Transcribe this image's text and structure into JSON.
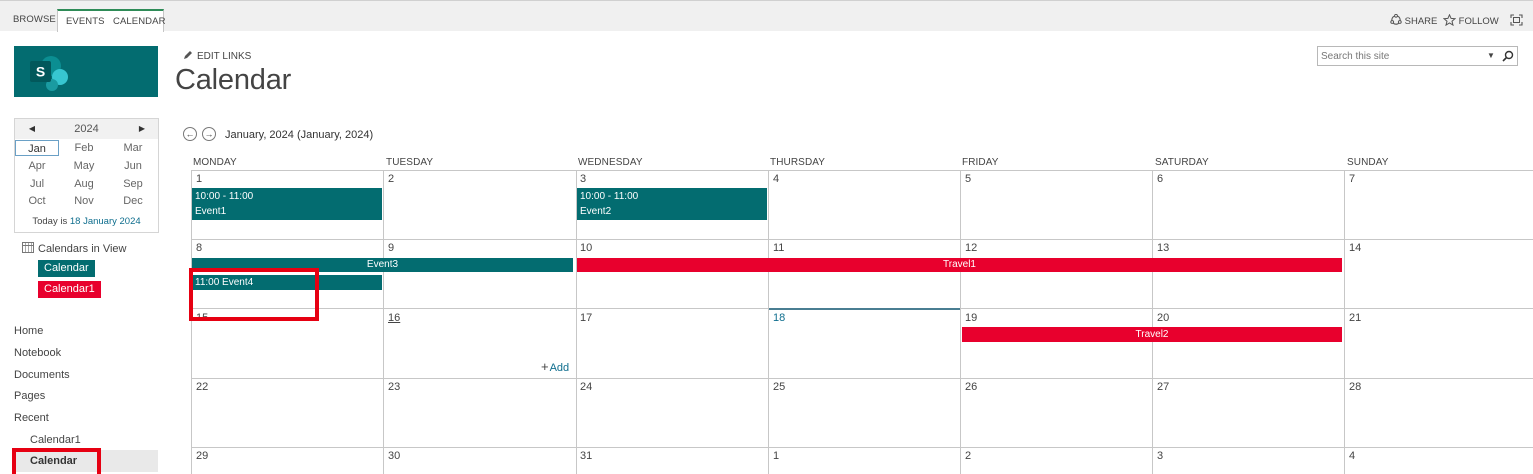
{
  "ribbon": {
    "tabs": [
      "BROWSE",
      "EVENTS",
      "CALENDAR"
    ],
    "share_label": "SHARE",
    "follow_label": "FOLLOW"
  },
  "nav": {
    "edit_links": "EDIT LINKS",
    "site_logo_letter": "S"
  },
  "page": {
    "title": "Calendar"
  },
  "search": {
    "placeholder": "Search this site"
  },
  "date_picker": {
    "year": "2024",
    "months": [
      "Jan",
      "Feb",
      "Mar",
      "Apr",
      "May",
      "Jun",
      "Jul",
      "Aug",
      "Sep",
      "Oct",
      "Nov",
      "Dec"
    ],
    "selected_month": "Jan",
    "today_prefix": "Today is",
    "today_link": "18 January 2024"
  },
  "calendars_in_view": {
    "title": "Calendars in View",
    "items": [
      {
        "label": "Calendar",
        "color": "#036c70"
      },
      {
        "label": "Calendar1",
        "color": "#e8002d"
      }
    ]
  },
  "quick_launch": {
    "items": [
      "Home",
      "Notebook",
      "Documents",
      "Pages",
      "Recent"
    ],
    "recent": [
      "Calendar1",
      "Calendar"
    ],
    "selected": "Calendar"
  },
  "calendar": {
    "month_label": "January, 2024 (January, 2024)",
    "day_headers": [
      "MONDAY",
      "TUESDAY",
      "WEDNESDAY",
      "THURSDAY",
      "FRIDAY",
      "SATURDAY",
      "SUNDAY"
    ],
    "weeks": [
      [
        "1",
        "2",
        "3",
        "4",
        "5",
        "6",
        "7"
      ],
      [
        "8",
        "9",
        "10",
        "11",
        "12",
        "13",
        "14"
      ],
      [
        "15",
        "16",
        "17",
        "18",
        "19",
        "20",
        "21"
      ],
      [
        "22",
        "23",
        "24",
        "25",
        "26",
        "27",
        "28"
      ],
      [
        "29",
        "30",
        "31",
        "1",
        "2",
        "3",
        "4"
      ]
    ],
    "today_date": "18",
    "add_label": "Add",
    "events": {
      "event1": {
        "time": "10:00 - 11:00",
        "title": "Event1"
      },
      "event2": {
        "time": "10:00 - 11:00",
        "title": "Event2"
      },
      "event3": {
        "title": "Event3"
      },
      "event4": {
        "label": "11:00 Event4"
      },
      "travel1": {
        "title": "Travel1"
      },
      "travel2": {
        "title": "Travel2"
      }
    }
  },
  "colors": {
    "calendar_event": "#036c70",
    "calendar1_event": "#e8002d",
    "highlight_box": "#e60012",
    "link": "#0f6e8e"
  }
}
